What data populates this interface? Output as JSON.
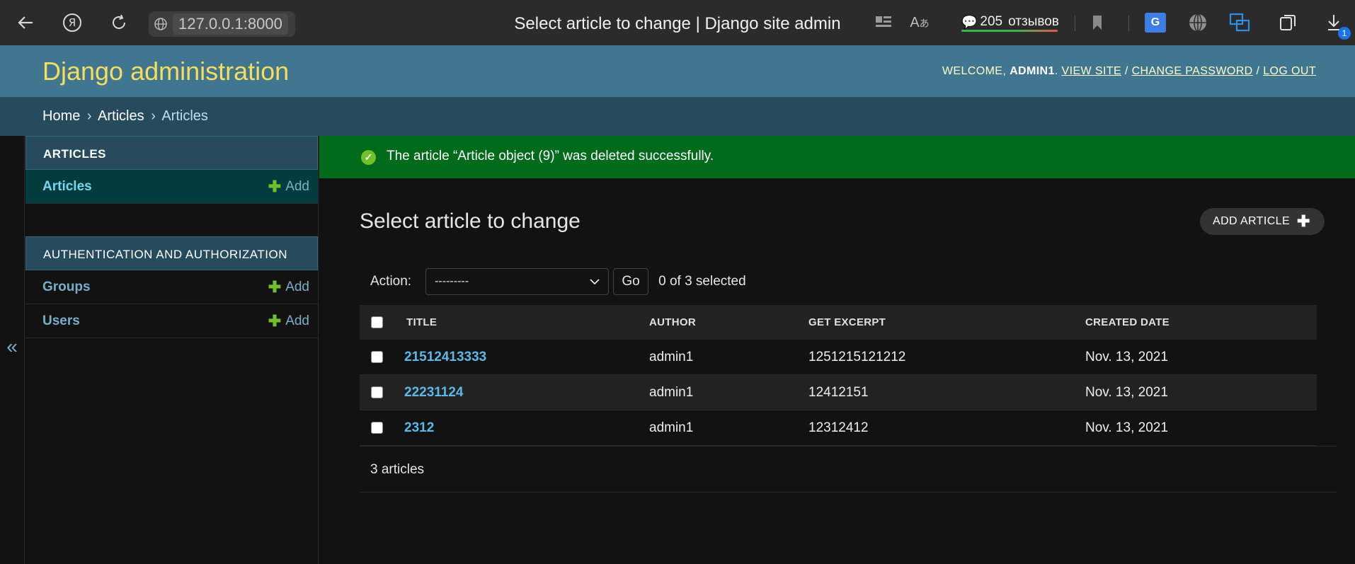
{
  "browser": {
    "url": "127.0.0.1:8000",
    "tab_title": "Select article to change | Django site admin",
    "reviews_count": "205",
    "reviews_label": "отзывов",
    "downloads_badge": "1",
    "translate_label": "G"
  },
  "header": {
    "branding": "Django administration",
    "welcome": "WELCOME, ",
    "username": "ADMIN1",
    "after_user": ". ",
    "view_site": "VIEW SITE",
    "slash1": " / ",
    "change_password": "CHANGE PASSWORD",
    "slash2": " / ",
    "log_out": "LOG OUT"
  },
  "breadcrumbs": {
    "home": "Home",
    "sep": "›",
    "app": "Articles",
    "current": "Articles"
  },
  "sidebar": {
    "toggle": "«",
    "modules": [
      {
        "caption": "ARTICLES",
        "rows": [
          {
            "label": "Articles",
            "add": "Add"
          }
        ]
      },
      {
        "caption": "AUTHENTICATION AND AUTHORIZATION",
        "rows": [
          {
            "label": "Groups",
            "add": "Add"
          },
          {
            "label": "Users",
            "add": "Add"
          }
        ]
      }
    ]
  },
  "message": {
    "text": "The article “Article object (9)” was deleted successfully.",
    "icon": "✓"
  },
  "content": {
    "title": "Select article to change",
    "add_button": "ADD ARTICLE",
    "add_icon": "✚"
  },
  "actions": {
    "label": "Action:",
    "selected_option": "---------",
    "go": "Go",
    "selected_count": "0 of 3 selected"
  },
  "table": {
    "headers": [
      "TITLE",
      "AUTHOR",
      "GET EXCERPT",
      "CREATED DATE"
    ],
    "rows": [
      {
        "title": "21512413333",
        "author": "admin1",
        "excerpt": "1251215121212",
        "date": "Nov. 13, 2021"
      },
      {
        "title": "22231124",
        "author": "admin1",
        "excerpt": "12412151",
        "date": "Nov. 13, 2021"
      },
      {
        "title": "2312",
        "author": "admin1",
        "excerpt": "12312412",
        "date": "Nov. 13, 2021"
      }
    ]
  },
  "paginator": {
    "text": "3 articles"
  },
  "colors": {
    "header_bg": "#417690",
    "breadcrumbs_bg": "#264b5d",
    "branding": "#f5dd5d",
    "link": "#79aec8",
    "success_bg": "#006b1b",
    "add_green": "#70bf2b"
  }
}
